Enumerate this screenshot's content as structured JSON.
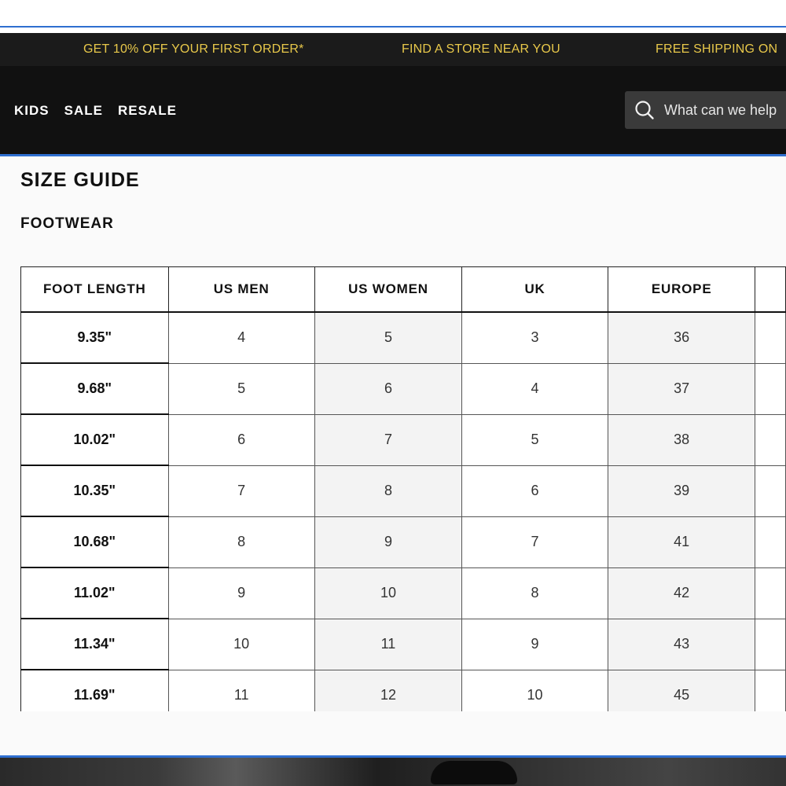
{
  "promo": {
    "items": [
      "GET 10% OFF YOUR FIRST ORDER*",
      "FIND A STORE NEAR YOU",
      "FREE SHIPPING ON"
    ]
  },
  "nav": {
    "links": [
      "KIDS",
      "SALE",
      "RESALE"
    ]
  },
  "search": {
    "placeholder": "What can we help",
    "icon": "search-icon"
  },
  "size_guide": {
    "title": "SIZE GUIDE",
    "subtitle": "FOOTWEAR",
    "columns": [
      "FOOT LENGTH",
      "US MEN",
      "US WOMEN",
      "UK",
      "EUROPE"
    ],
    "rows": [
      [
        "9.35\"",
        "4",
        "5",
        "3",
        "36"
      ],
      [
        "9.68\"",
        "5",
        "6",
        "4",
        "37"
      ],
      [
        "10.02\"",
        "6",
        "7",
        "5",
        "38"
      ],
      [
        "10.35\"",
        "7",
        "8",
        "6",
        "39"
      ],
      [
        "10.68\"",
        "8",
        "9",
        "7",
        "41"
      ],
      [
        "11.02\"",
        "9",
        "10",
        "8",
        "42"
      ],
      [
        "11.34\"",
        "10",
        "11",
        "9",
        "43"
      ],
      [
        "11.69\"",
        "11",
        "12",
        "10",
        "45"
      ]
    ]
  },
  "colors": {
    "promo_text": "#e8c84a",
    "promo_bg": "#1b1b1b",
    "nav_bg": "#111111",
    "accent_rule": "#2f6fd0"
  }
}
